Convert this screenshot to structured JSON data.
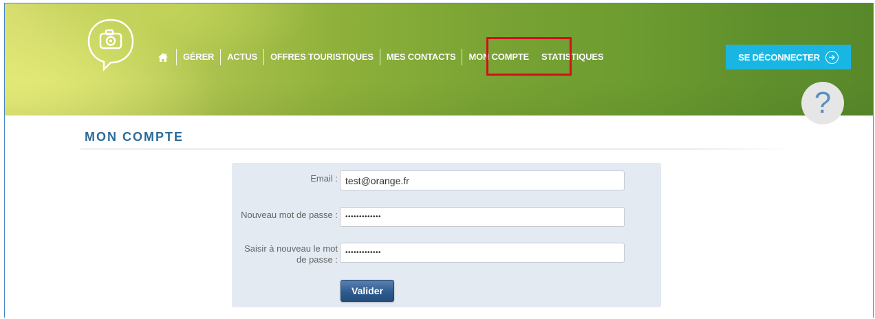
{
  "nav": {
    "home_icon": "home-icon",
    "items": [
      {
        "label": "GÉRER"
      },
      {
        "label": "ACTUS"
      },
      {
        "label": "OFFRES TOURISTIQUES"
      },
      {
        "label": "MES CONTACTS"
      },
      {
        "label": "MON COMPTE",
        "active": true
      },
      {
        "label": "STATISTIQUES"
      }
    ]
  },
  "header": {
    "logo_icon": "camera-speech-bubble-icon",
    "logout_label": "SE DÉCONNECTER",
    "logout_icon": "arrow-right-circle-icon",
    "help_label": "?"
  },
  "page": {
    "title": "MON COMPTE"
  },
  "form": {
    "email_label": "Email :",
    "email_value": "test@orange.fr",
    "new_password_label": "Nouveau mot de passe :",
    "new_password_value": "•••••••••••••",
    "confirm_password_label": "Saisir à nouveau le mot de passe :",
    "confirm_password_value": "•••••••••••••",
    "submit_label": "Valider"
  },
  "colors": {
    "accent": "#19b6e3",
    "title": "#2c6c9a",
    "highlight": "#d0101a",
    "panel": "#e3eaf2",
    "button": "#2e5c8f"
  }
}
